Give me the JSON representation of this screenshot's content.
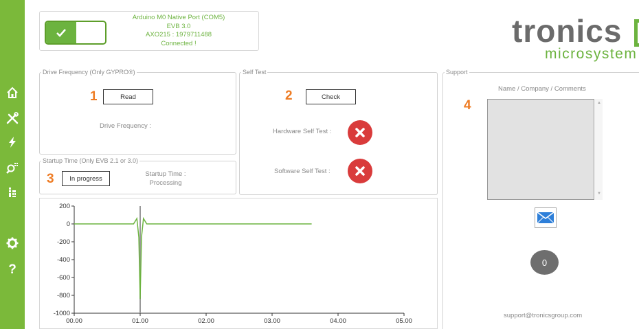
{
  "connection": {
    "port": "Arduino M0 Native Port (COM5)",
    "evb": "EVB 3.0",
    "sensor": "AXO215 : 1979711488",
    "status": "Connected !",
    "toggle_on": true
  },
  "logo": {
    "main": "tronics",
    "sub": "microsystem"
  },
  "sidebar": {
    "items": [
      {
        "icon": "home-icon"
      },
      {
        "icon": "tools-icon"
      },
      {
        "icon": "lightning-icon"
      },
      {
        "icon": "search-icon"
      },
      {
        "icon": "chip-icon"
      },
      {
        "icon": "gear-icon"
      },
      {
        "icon": "help-icon"
      }
    ]
  },
  "drive_frequency": {
    "legend": "Drive Frequency (Only GYPRO®)",
    "step": "1",
    "button": "Read",
    "label": "Drive Frequency :"
  },
  "startup_time": {
    "legend": "Startup Time (Only EVB 2.1 or 3.0)",
    "step": "3",
    "button": "In progress",
    "label": "Startup Time :",
    "value": "Processing"
  },
  "self_test": {
    "legend": "Self Test",
    "step": "2",
    "button": "Check",
    "hardware_label": "Hardware Self Test :",
    "software_label": "Software Self Test :",
    "hardware_status": "fail",
    "software_status": "fail"
  },
  "support": {
    "legend": "Support",
    "step": "4",
    "prompt": "Name / Company / Comments",
    "comment_value": "",
    "counter": "0",
    "email": "support@tronicsgroup.com"
  },
  "chart_data": {
    "type": "line",
    "xlim": [
      0,
      5
    ],
    "ylim": [
      -1000,
      200
    ],
    "x_ticks": [
      "00.00",
      "01.00",
      "02.00",
      "03.00",
      "04.00",
      "05.00"
    ],
    "y_ticks": [
      "200",
      "0",
      "-200",
      "-400",
      "-600",
      "-800",
      "-1000"
    ],
    "y_tick_values": [
      200,
      0,
      -200,
      -400,
      -600,
      -800,
      -1000
    ],
    "series": [
      {
        "color": "#6cb33f",
        "x": [
          0,
          0.9,
          0.95,
          0.98,
          1.0,
          1.02,
          1.05,
          1.1,
          3.6
        ],
        "y": [
          0,
          0,
          60,
          -150,
          -840,
          -150,
          60,
          0,
          0
        ]
      }
    ],
    "marker_line": {
      "x": 1.0,
      "color": "#999999"
    }
  }
}
